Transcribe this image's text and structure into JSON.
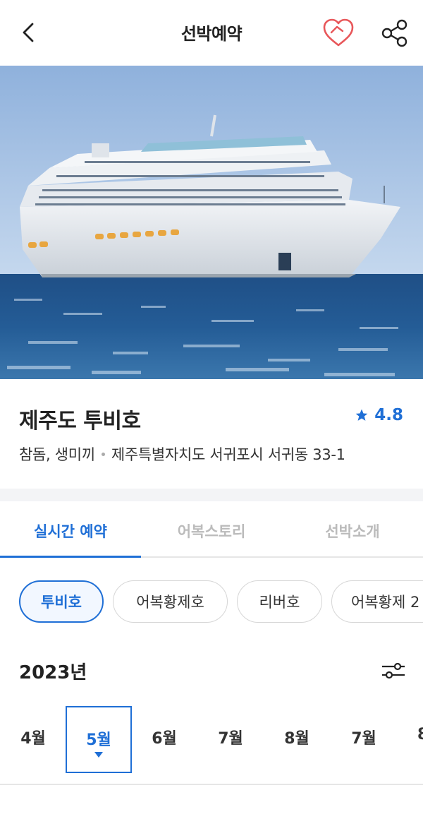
{
  "header": {
    "title": "선박예약",
    "back_icon": "chevron-left-icon",
    "favorite_icon": "heart-icon",
    "share_icon": "share-icon"
  },
  "colors": {
    "accent": "#1f6fd6",
    "favorite": "#e8575a",
    "tab_inactive": "#bbbbbb"
  },
  "ship": {
    "name": "제주도 투비호",
    "rating": "4.8",
    "rating_icon": "star-icon",
    "category": "참돔, 생미끼",
    "address": "제주특별자치도 서귀포시 서귀동 33-1"
  },
  "tabs": [
    {
      "label": "실시간 예약",
      "active": true
    },
    {
      "label": "어복스토리",
      "active": false
    },
    {
      "label": "선박소개",
      "active": false
    }
  ],
  "boats": [
    {
      "label": "투비호",
      "active": true
    },
    {
      "label": "어복황제호",
      "active": false
    },
    {
      "label": "리버호",
      "active": false
    },
    {
      "label": "어복황제 2",
      "active": false
    }
  ],
  "calendar": {
    "year": "2023년",
    "filter_icon": "sliders-icon",
    "months": [
      {
        "label": "4월",
        "active": false
      },
      {
        "label": "5월",
        "active": true
      },
      {
        "label": "6월",
        "active": false
      },
      {
        "label": "7월",
        "active": false
      },
      {
        "label": "8월",
        "active": false
      },
      {
        "label": "7월",
        "active": false
      },
      {
        "label": "8",
        "active": false
      }
    ]
  }
}
